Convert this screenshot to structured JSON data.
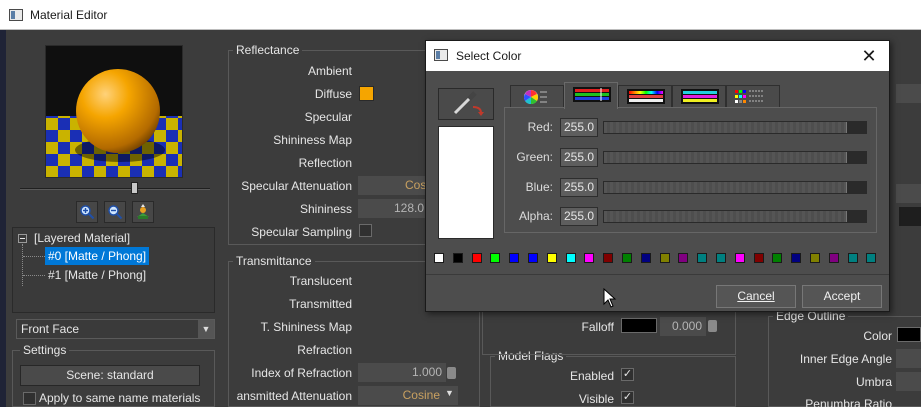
{
  "main_window": {
    "title": "Material Editor",
    "material_tree": {
      "root": "[Layered Material]",
      "items": [
        "#0 [Matte / Phong]",
        "#1 [Matte / Phong]"
      ],
      "selected_index": 0
    },
    "face_select": "Front Face",
    "settings": {
      "title": "Settings",
      "scene_button": "Scene: standard",
      "apply_label": "Apply to same name materials"
    },
    "reflectance": {
      "title": "Reflectance",
      "labels": [
        "Ambient",
        "Diffuse",
        "Specular",
        "Shininess Map",
        "Reflection",
        "Specular Attenuation",
        "Shininess",
        "Specular Sampling"
      ],
      "diffuse_color": "#f5a500",
      "spec_atten_value": "Cos",
      "shininess_value": "128.0"
    },
    "transmittance": {
      "title": "Transmittance",
      "labels": [
        "Translucent",
        "Transmitted",
        "T. Shininess Map",
        "Refraction",
        "Index of Refraction",
        "ansmitted Attenuation"
      ],
      "ior_value": "1.000",
      "atten_value": "Cosine"
    },
    "falloff": {
      "label": "Falloff",
      "value": "0.000"
    },
    "model_flags": {
      "title": "Model Flags",
      "enabled_label": "Enabled",
      "visible_label": "Visible",
      "enabled_checked": "✓",
      "visible_checked": "✓"
    },
    "edge_outline": {
      "title": "Edge Outline",
      "labels": [
        "Color",
        "Inner Edge Angle",
        "Umbra",
        "Penumbra Ratio"
      ]
    }
  },
  "dialog": {
    "title": "Select Color",
    "close_glyph": "✕",
    "channels": [
      {
        "label": "Red:",
        "value": "255.0",
        "fraction": 1.0
      },
      {
        "label": "Green:",
        "value": "255.0",
        "fraction": 1.0
      },
      {
        "label": "Blue:",
        "value": "255.0",
        "fraction": 1.0
      },
      {
        "label": "Alpha:",
        "value": "255.0",
        "fraction": 1.0
      }
    ],
    "current_color": "#ffffff",
    "tabs": [
      "wheel",
      "rgb-sliders",
      "hsv-bars",
      "cmy-bars",
      "palette-grid"
    ],
    "active_tab": 1,
    "palette": [
      "#ffffff",
      "#000000",
      "#ff0000",
      "#00ff00",
      "#0000ff",
      "#0000ff",
      "#ffff00",
      "#00ffff",
      "#ff00ff",
      "#800000",
      "#008000",
      "#000080",
      "#808000",
      "#800080",
      "#008080",
      "#008080",
      "#ff00ff",
      "#800000",
      "#008000",
      "#000080",
      "#808000",
      "#800080",
      "#008080",
      "#008080"
    ],
    "cancel_label": "Cancel",
    "accept_label": "Accept"
  }
}
